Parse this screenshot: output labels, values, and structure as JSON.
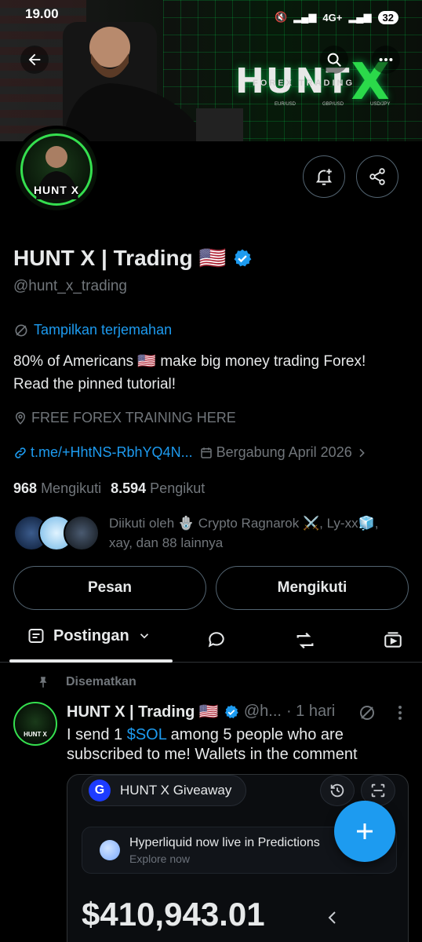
{
  "status_bar": {
    "time": "19.00",
    "network": "4G+",
    "battery": "32"
  },
  "banner": {
    "logo_text": "HUNT",
    "logo_x": "X",
    "logo_sub": "FOREX TRADING",
    "pairs": [
      "EUR/USD",
      "GBP/USD",
      "USD/JPY"
    ]
  },
  "avatar": {
    "label": "HUNT X"
  },
  "profile": {
    "name": "HUNT X | Trading 🇺🇸",
    "handle": "@hunt_x_trading",
    "translate_label": "Tampilkan terjemahan",
    "bio_line1": "80% of Americans 🇺🇸 make big money trading Forex!",
    "bio_line2": "Read the pinned tutorial!",
    "location": "FREE FOREX TRAINING HERE",
    "link": "t.me/+HhtNS-RbhYQ4N...",
    "joined": "Bergabung April 2026",
    "following_count": "968",
    "following_label": "Mengikuti",
    "followers_count": "8.594",
    "followers_label": "Pengikut",
    "followed_by_line1": "Diikuti oleh 🪬 Crypto Ragnarok ⚔️, Ly-xx🧊,",
    "followed_by_line2": "xay, dan 88 lainnya"
  },
  "actions": {
    "message_label": "Pesan",
    "following_label": "Mengikuti"
  },
  "tabs": {
    "active_label": "Postingan"
  },
  "post": {
    "pinned_label": "Disematkan",
    "author": "HUNT X | Trading 🇺🇸",
    "handle": "@h...",
    "time": "· 1 hari",
    "text_before": "I send 1 ",
    "cashtag": "$SOL",
    "text_after": " among 5 people who are subscribed to me! Wallets in the comment",
    "card": {
      "wallet_name": "HUNT X Giveaway",
      "wallet_logo": "G",
      "notice_title": "Hyperliquid now live in Predictions",
      "notice_sub": "Explore now",
      "balance": "$410,943.01"
    }
  },
  "colors": {
    "accent": "#1d9bf0",
    "text": "#e7e9ea",
    "muted": "#71767b",
    "border": "#536471",
    "brand_green": "#35e04f"
  }
}
